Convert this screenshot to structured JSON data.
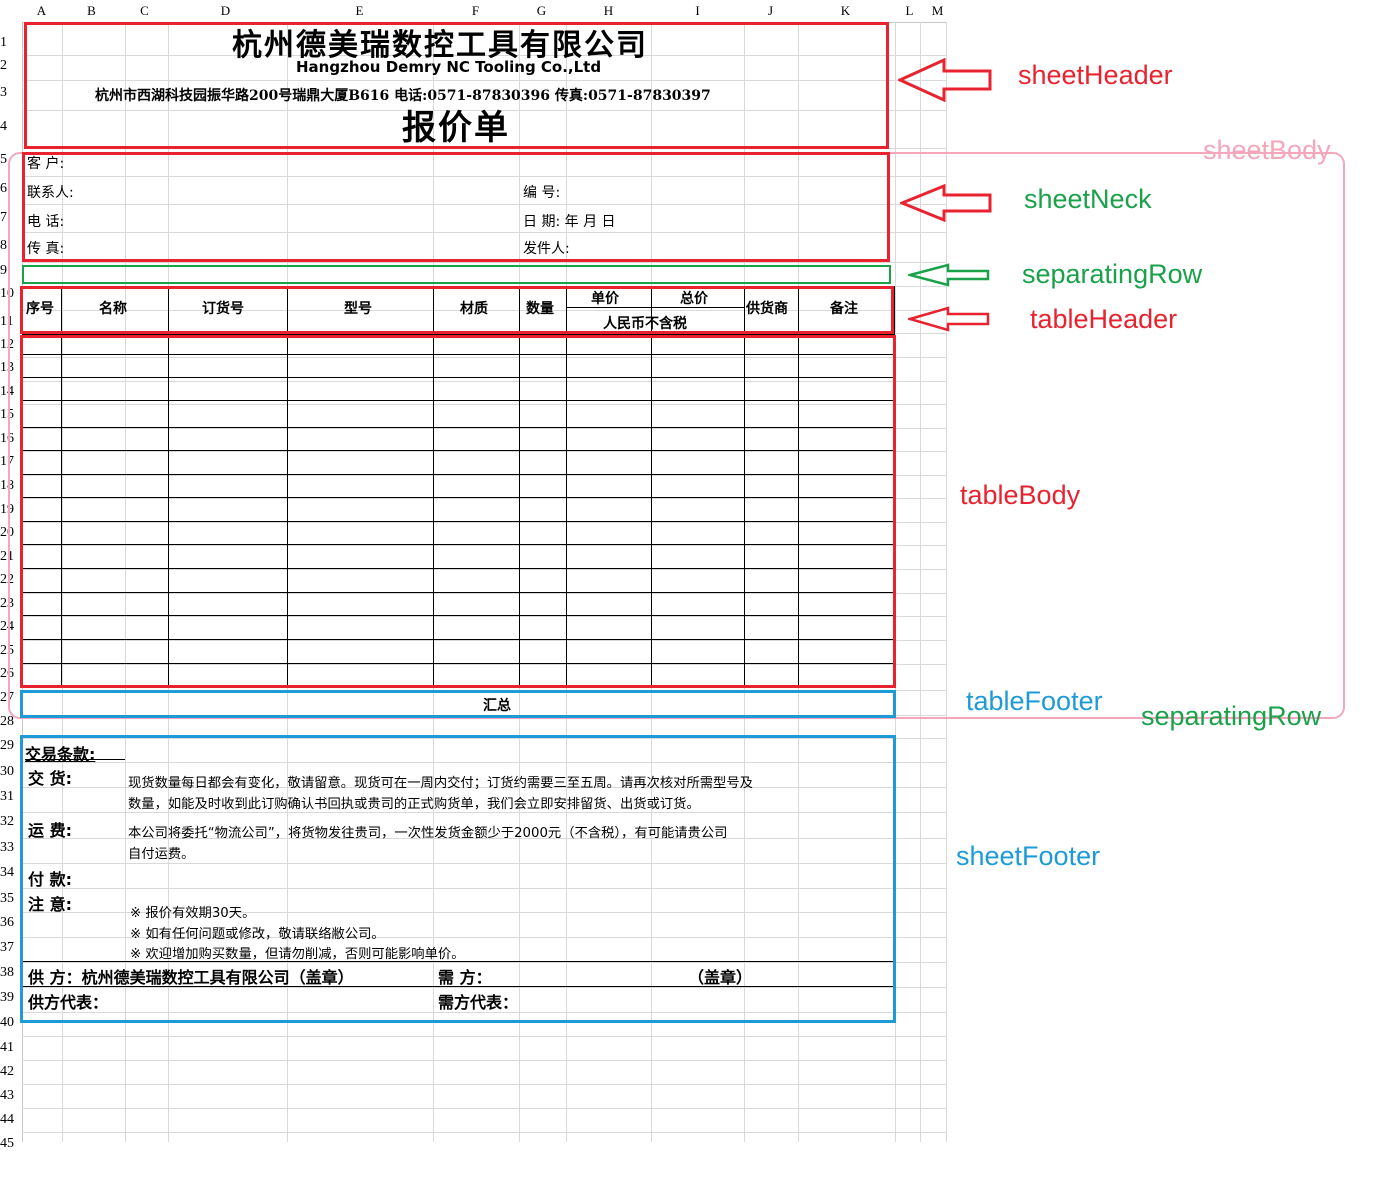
{
  "columns": [
    "A",
    "B",
    "C",
    "D",
    "E",
    "F",
    "G",
    "H",
    "I",
    "J",
    "K",
    "L",
    "M"
  ],
  "rows": [
    "1",
    "2",
    "3",
    "4",
    "5",
    "6",
    "7",
    "8",
    "9",
    "10",
    "11",
    "12",
    "13",
    "14",
    "15",
    "16",
    "17",
    "18",
    "19",
    "20",
    "21",
    "22",
    "23",
    "24",
    "25",
    "26",
    "27",
    "28",
    "29",
    "30",
    "31",
    "32",
    "33",
    "34",
    "35",
    "36",
    "37",
    "38",
    "39",
    "40",
    "41",
    "42",
    "43",
    "44",
    "45"
  ],
  "header": {
    "company_cn": "杭州德美瑞数控工具有限公司",
    "company_en": "Hangzhou Demry NC Tooling Co.,Ltd",
    "address": "杭州市西湖科技园振华路200号瑞鼎大厦B616    电话:0571-87830396  传真:0571-87830397",
    "doc_title": "报价单"
  },
  "neck": {
    "customer": "客  户:",
    "contact": "联系人:",
    "number": "编  号:",
    "phone": "电  话:",
    "date": "日  期:   年 月 日",
    "fax": "传  真:",
    "sender": "发件人:"
  },
  "table": {
    "headers": [
      "序号",
      "名称",
      "订货号",
      "型号",
      "材质",
      "数量",
      "单价",
      "总价",
      "供货商",
      "备注"
    ],
    "currency_note": "人民币不含税",
    "total_label": "汇总"
  },
  "footer": {
    "terms_title": "交易条款:",
    "delivery_label": "交    货:",
    "delivery_text_1": "现货数量每日都会有变化，敬请留意。现货可在一周内交付；订货约需要三至五周。请再次核对所需型号及",
    "delivery_text_2": "数量，如能及时收到此订购确认书回执或贵司的正式购货单，我们会立即安排留货、出货或订货。",
    "freight_label": "运    费:",
    "freight_text_1": "本公司将委托“物流公司”，将货物发往贵司，一次性发货金额少于2000元（不含税），有可能请贵公司",
    "freight_text_2": "自付运费。",
    "payment_label": "付    款:",
    "notice_label": "注    意:",
    "notice_1": "※  报价有效期30天。",
    "notice_2": "※  如有任何问题或修改，敬请联络敝公司。",
    "notice_3": "※  欢迎增加购买数量，但请勿削减，否则可能影响单价。",
    "supplier": "供  方：杭州德美瑞数控工具有限公司（盖章）",
    "buyer": "需  方：",
    "buyer_seal": "（盖章）",
    "supplier_rep": "供方代表：",
    "buyer_rep": "需方代表："
  },
  "annotations": {
    "sheetHeader": "sheetHeader",
    "sheetBody": "sheetBody",
    "sheetNeck": "sheetNeck",
    "separatingRow": "separatingRow",
    "tableHeader": "tableHeader",
    "tableBody": "tableBody",
    "tableFooter": "tableFooter",
    "separatingRow2": "separatingRow",
    "sheetFooter": "sheetFooter"
  },
  "colors": {
    "red": "#e8232f",
    "green": "#1aa14a",
    "blue": "#1e9bd7",
    "pink": "#f4a7bb",
    "grid": "#d9d9d9"
  }
}
